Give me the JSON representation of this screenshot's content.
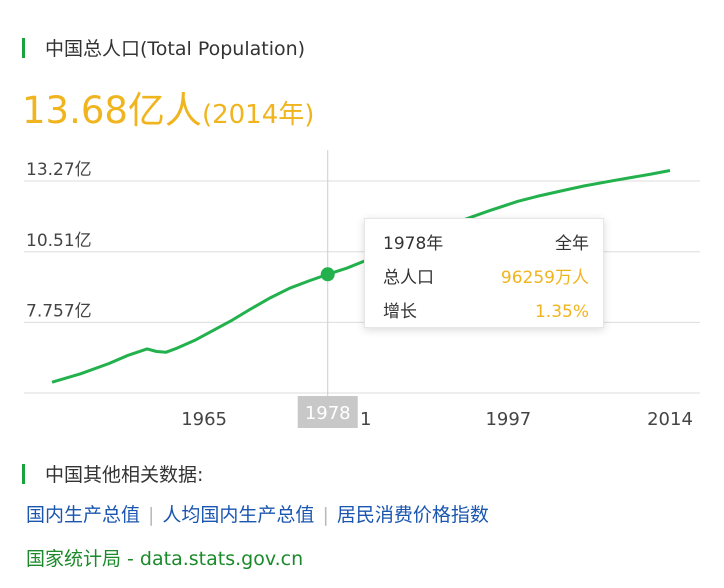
{
  "header": {
    "title": "中国总人口(Total Population)"
  },
  "headline": {
    "value": "13.68亿人",
    "year": "(2014年)"
  },
  "chart_data": {
    "type": "line",
    "y_ticks": [
      {
        "label": "13.27亿",
        "value": 13.27
      },
      {
        "label": "10.51亿",
        "value": 10.51
      },
      {
        "label": "7.757亿",
        "value": 7.757
      }
    ],
    "x_ticks": [
      {
        "label": "1965",
        "value": 1965
      },
      {
        "label": "1",
        "value": 1982
      },
      {
        "label": "1997",
        "value": 1997
      },
      {
        "label": "2014",
        "value": 2014
      }
    ],
    "xlim": [
      1950,
      2020
    ],
    "ylim": [
      5.0,
      14.0
    ],
    "grid": true,
    "line_color": "#22b14c",
    "x": [
      1949,
      1952,
      1955,
      1957,
      1959,
      1960,
      1961,
      1962,
      1964,
      1966,
      1968,
      1970,
      1972,
      1974,
      1976,
      1978,
      1980,
      1982,
      1985,
      1988,
      1990,
      1993,
      1995,
      1998,
      2000,
      2003,
      2005,
      2008,
      2010,
      2012,
      2014
    ],
    "y": [
      5.42,
      5.75,
      6.15,
      6.47,
      6.72,
      6.62,
      6.59,
      6.73,
      7.05,
      7.45,
      7.85,
      8.3,
      8.72,
      9.09,
      9.37,
      9.63,
      9.87,
      10.17,
      10.59,
      11.1,
      11.43,
      11.85,
      12.11,
      12.48,
      12.67,
      12.92,
      13.08,
      13.28,
      13.41,
      13.54,
      13.68
    ],
    "highlight": {
      "x": 1978,
      "y": 9.63,
      "label": "1978"
    }
  },
  "tooltip": {
    "year": "1978年",
    "period": "全年",
    "metric_label": "总人口",
    "metric_value": "96259万人",
    "growth_label": "增长",
    "growth_value": "1.35%"
  },
  "related": {
    "title": "中国其他相关数据:",
    "links": [
      "国内生产总值",
      "人均国内生产总值",
      "居民消费价格指数"
    ],
    "separator": "|"
  },
  "source": {
    "text": "国家统计局 - data.stats.gov.cn"
  },
  "colors": {
    "accent": "#f0b41e",
    "green": "#22b14c",
    "link": "#1a56b0"
  }
}
